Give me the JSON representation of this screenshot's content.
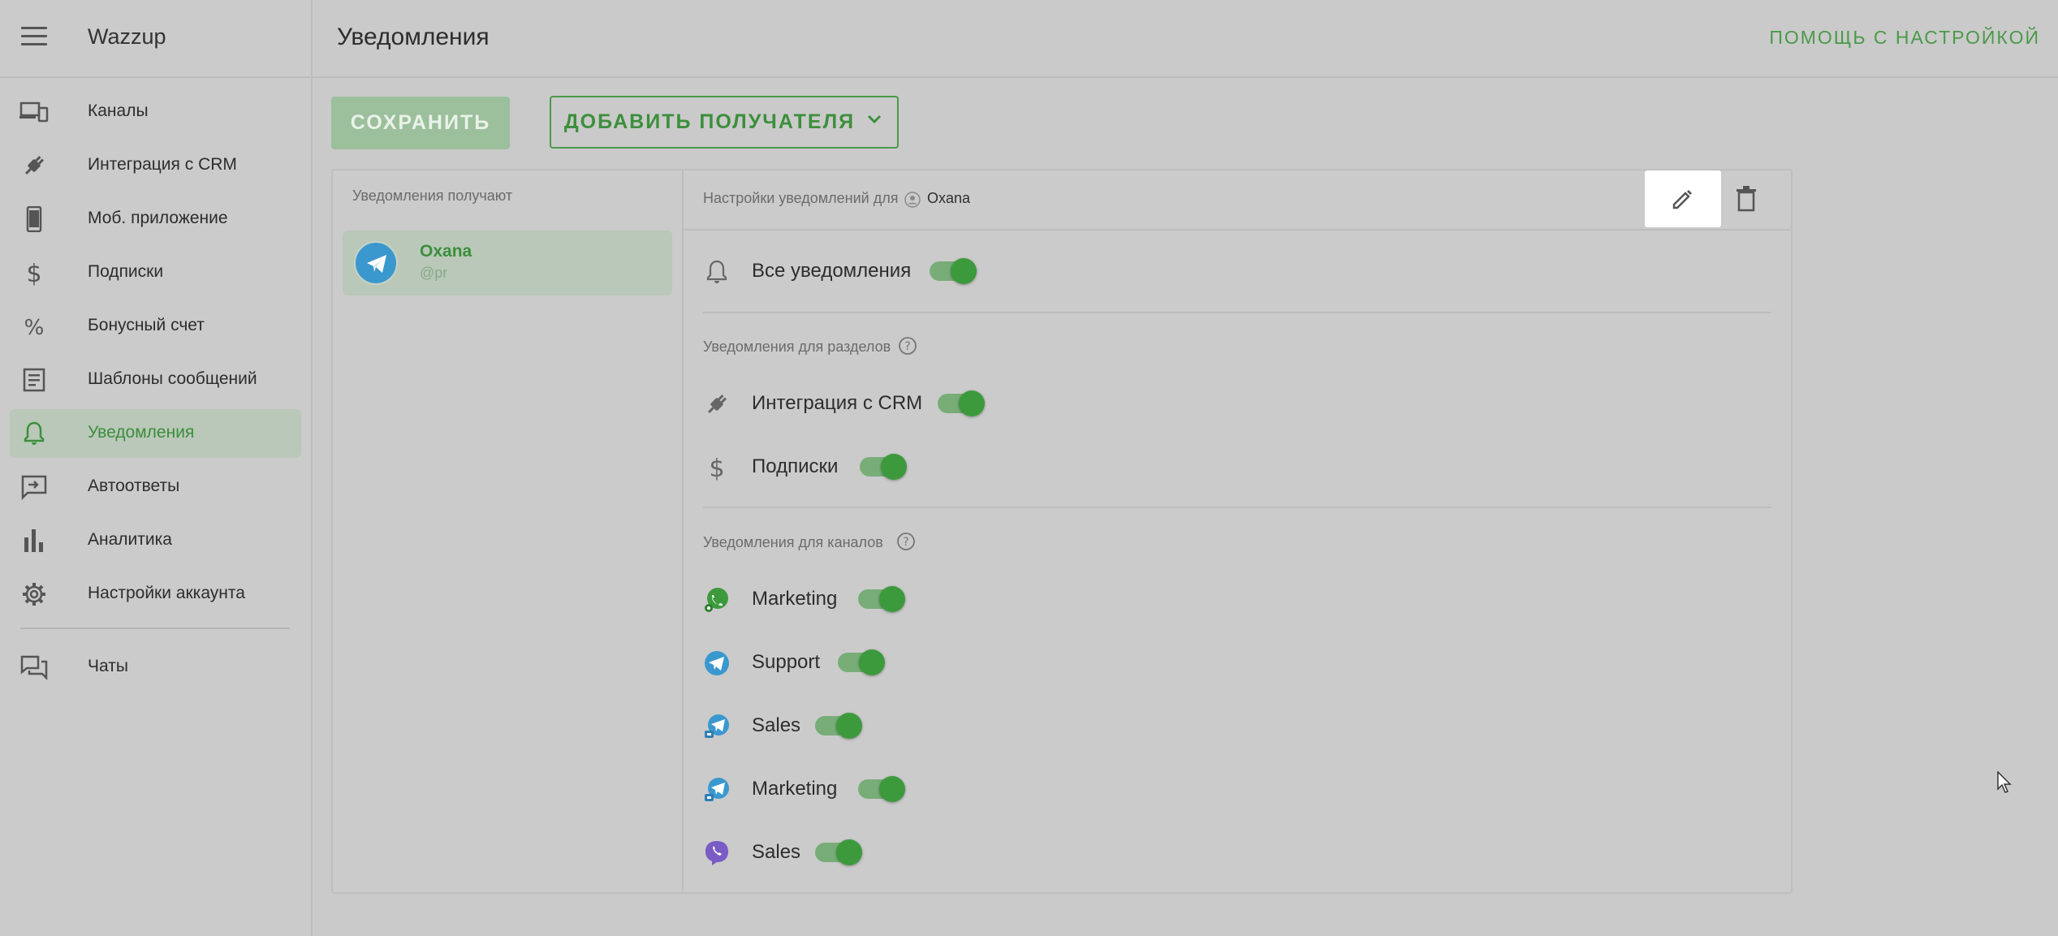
{
  "sidebar": {
    "app_title": "Wazzup",
    "items": [
      {
        "label": "Каналы",
        "icon": "devices-icon"
      },
      {
        "label": "Интеграция с CRM",
        "icon": "plug-icon"
      },
      {
        "label": "Моб. приложение",
        "icon": "smartphone-icon"
      },
      {
        "label": "Подписки",
        "icon": "dollar-icon"
      },
      {
        "label": "Бонусный счет",
        "icon": "percent-icon"
      },
      {
        "label": "Шаблоны сообщений",
        "icon": "template-icon"
      },
      {
        "label": "Уведомления",
        "icon": "bell-icon",
        "active": true
      },
      {
        "label": "Автоответы",
        "icon": "autoreply-icon"
      },
      {
        "label": "Аналитика",
        "icon": "bar-chart-icon"
      },
      {
        "label": "Настройки аккаунта",
        "icon": "gear-icon"
      },
      {
        "label": "Чаты",
        "icon": "chats-icon"
      }
    ]
  },
  "header": {
    "title": "Уведомления",
    "help_link": "ПОМОЩЬ С НАСТРОЙКОЙ"
  },
  "toolbar": {
    "save_label": "СОХРАНИТЬ",
    "add_recipient_label": "ДОБАВИТЬ ПОЛУЧАТЕЛЯ"
  },
  "recipients": {
    "title": "Уведомления получают",
    "items": [
      {
        "name": "Oxana",
        "handle": "@pr"
      }
    ]
  },
  "settings": {
    "for_label": "Настройки уведомлений для",
    "recipient_name": "Oxana",
    "all": {
      "label": "Все уведомления",
      "enabled": true
    },
    "sections_title": "Уведомления для разделов",
    "sections": [
      {
        "label": "Интеграция с CRM",
        "enabled": true
      },
      {
        "label": "Подписки",
        "enabled": true
      }
    ],
    "channels_title": "Уведомления для каналов",
    "channels": [
      {
        "label": "Marketing",
        "icon": "whatsapp-icon",
        "enabled": true
      },
      {
        "label": "Support",
        "icon": "telegram-icon",
        "enabled": true
      },
      {
        "label": "Sales",
        "icon": "telegram-personal-icon",
        "enabled": true
      },
      {
        "label": "Marketing",
        "icon": "telegram-personal-icon",
        "enabled": true
      },
      {
        "label": "Sales",
        "icon": "viber-icon",
        "enabled": true
      }
    ]
  },
  "colors": {
    "accent": "#3c9a3c",
    "background": "#cacaca",
    "active_item": "#b9c8b9"
  }
}
